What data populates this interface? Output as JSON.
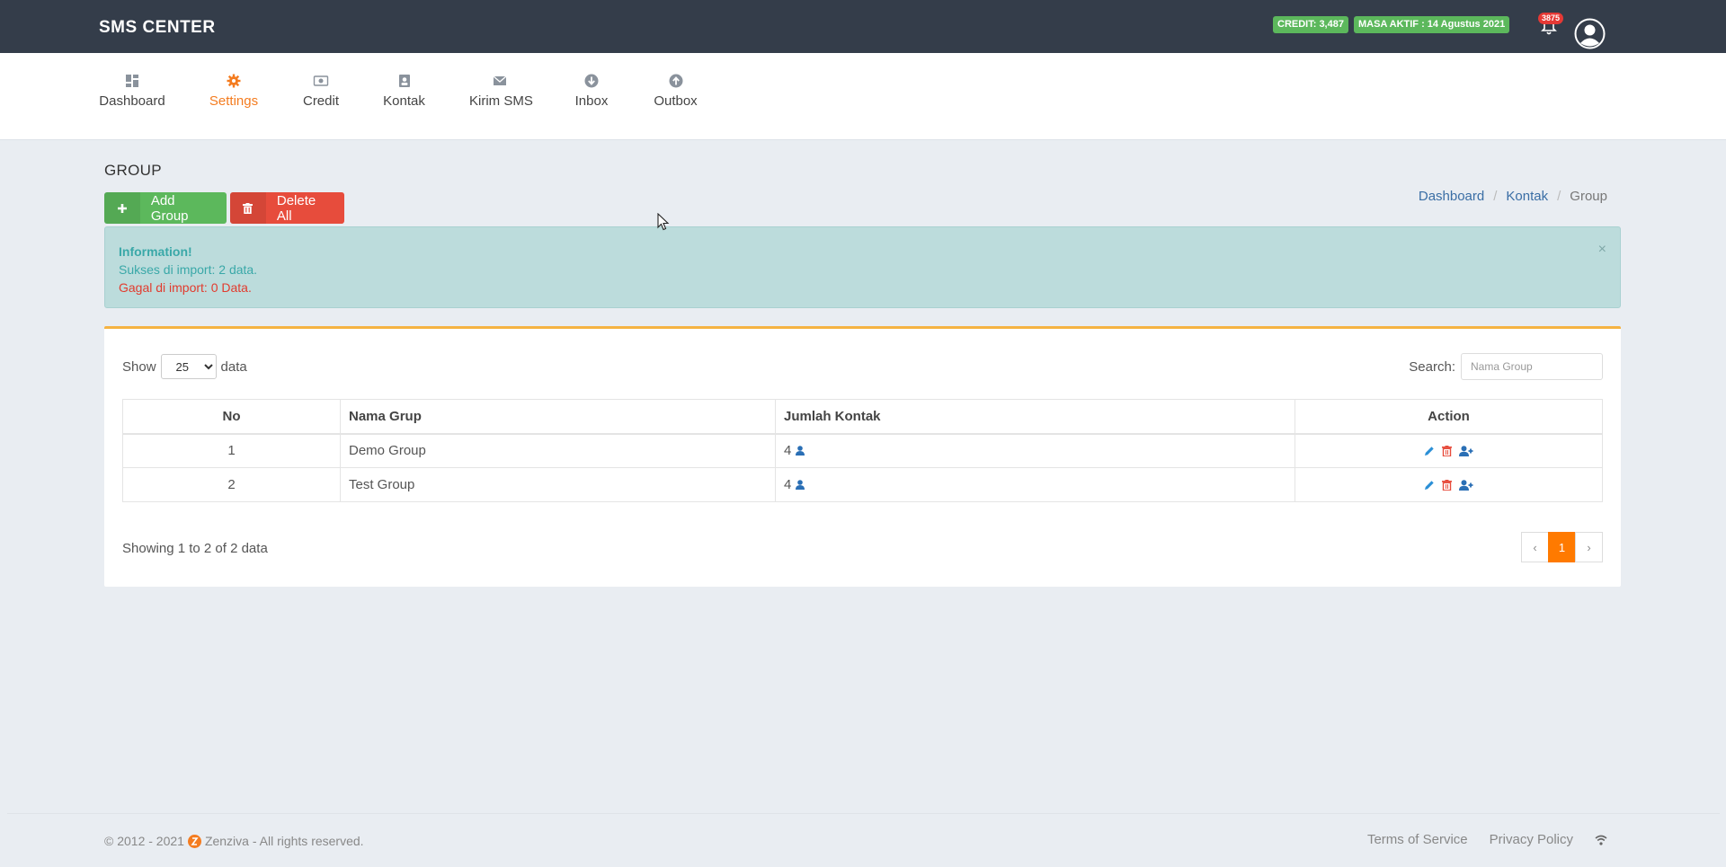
{
  "header": {
    "brand": "SMS CENTER",
    "credit": "CREDIT: 3,487",
    "masa_aktif": "MASA AKTIF : 14 Agustus 2021",
    "notif_count": "3875"
  },
  "nav": [
    {
      "label": "Dashboard",
      "icon": "dashboard-icon"
    },
    {
      "label": "Settings",
      "icon": "gear-icon",
      "active": true
    },
    {
      "label": "Credit",
      "icon": "money-icon"
    },
    {
      "label": "Kontak",
      "icon": "contacts-icon"
    },
    {
      "label": "Kirim SMS",
      "icon": "envelope-icon"
    },
    {
      "label": "Inbox",
      "icon": "arrow-down-circle-icon"
    },
    {
      "label": "Outbox",
      "icon": "arrow-up-circle-icon"
    }
  ],
  "page": {
    "title": "GROUP",
    "add_label": "Add Group",
    "delete_label": "Delete All"
  },
  "breadcrumb": [
    "Dashboard",
    "Kontak",
    "Group"
  ],
  "alert": {
    "title": "Information!",
    "success": "Sukses di import: 2 data.",
    "fail": "Gagal di import: 0 Data.",
    "close": "×"
  },
  "table_controls": {
    "show_label": "Show",
    "show_value": "25",
    "data_label": "data",
    "search_label": "Search:",
    "search_placeholder": "Nama Group"
  },
  "table": {
    "headers": [
      "No",
      "Nama Grup",
      "Jumlah Kontak",
      "Action"
    ],
    "rows": [
      {
        "no": "1",
        "name": "Demo Group",
        "count": "4"
      },
      {
        "no": "2",
        "name": "Test Group",
        "count": "4"
      }
    ]
  },
  "pagination": {
    "info": "Showing 1 to 2 of 2 data",
    "prev": "‹",
    "current": "1",
    "next": "›"
  },
  "footer": {
    "copyright_prefix": "© 2012 - 2021",
    "copyright_suffix": "Zenziva - All rights reserved.",
    "terms": "Terms of Service",
    "privacy": "Privacy Policy"
  },
  "colors": {
    "topbar": "#343d4a",
    "accent": "#f47c20",
    "add": "#5cb85c",
    "delete": "#e74c3c",
    "alert_bg": "#bcdcdc"
  }
}
